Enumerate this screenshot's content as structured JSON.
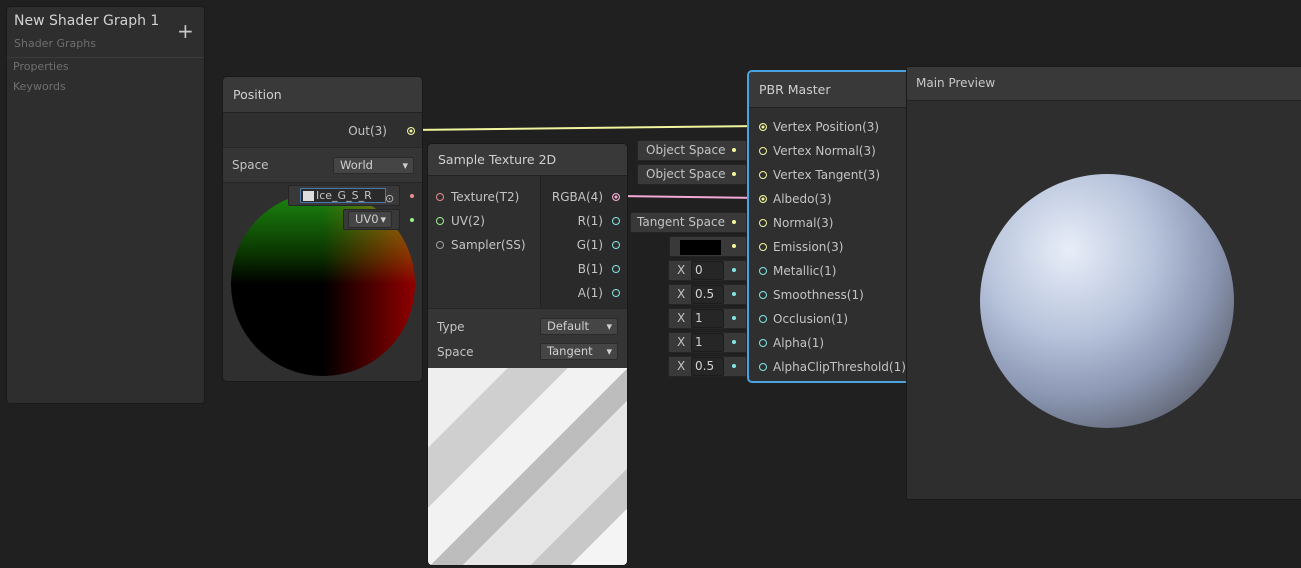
{
  "blackboard": {
    "title": "New Shader Graph 1",
    "subtitle": "Shader Graphs",
    "add_icon": "+",
    "sections": [
      "Properties",
      "Keywords"
    ]
  },
  "position_node": {
    "title": "Position",
    "output": "Out(3)",
    "space_label": "Space",
    "space_value": "World"
  },
  "sample_texture": {
    "title": "Sample Texture 2D",
    "inputs": [
      "Texture(T2)",
      "UV(2)",
      "Sampler(SS)"
    ],
    "outputs": [
      "RGBA(4)",
      "R(1)",
      "G(1)",
      "B(1)",
      "A(1)"
    ],
    "texture_value": "Ice_G_S_R",
    "uv_value": "UV0",
    "type_label": "Type",
    "type_value": "Default",
    "space_label": "Space",
    "space_value": "Tangent"
  },
  "pbr_master": {
    "title": "PBR Master",
    "inputs": [
      "Vertex Position(3)",
      "Vertex Normal(3)",
      "Vertex Tangent(3)",
      "Albedo(3)",
      "Normal(3)",
      "Emission(3)",
      "Metallic(1)",
      "Smoothness(1)",
      "Occlusion(1)",
      "Alpha(1)",
      "AlphaClipThreshold(1)"
    ],
    "inline": {
      "vertex_normal": "Object Space",
      "vertex_tangent": "Object Space",
      "normal": "Tangent Space",
      "x_label": "X",
      "metallic": "0",
      "smoothness": "0.5",
      "occlusion": "1",
      "alpha": "1",
      "alpha_clip": "0.5"
    },
    "emission_color": "#000000"
  },
  "main_preview": {
    "title": "Main Preview"
  },
  "colors": {
    "accent": "#4aa3e0",
    "wire_vector3": "#f1f59e",
    "wire_vector4": "#f3a9d5"
  }
}
